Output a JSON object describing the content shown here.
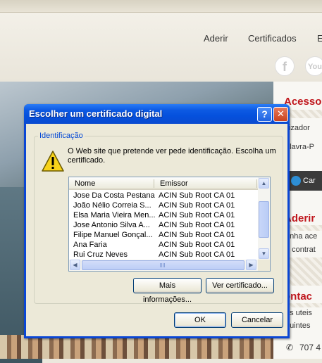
{
  "website": {
    "nav": [
      "Aderir",
      "Certificados",
      "E"
    ],
    "social": [
      "f",
      "You"
    ],
    "sidebar": {
      "section1_title": "Acesso",
      "section1_lines": [
        "ilizador",
        "alavra-P"
      ],
      "button_label": "Car",
      "section2_title": "Aderir",
      "section2_lines": [
        "enha ace",
        "e contrat"
      ],
      "section3_title": "ontac",
      "section3_lines": [
        "as uteis",
        "guintes"
      ],
      "phone": "707 4"
    }
  },
  "dialog": {
    "title": "Escolher um certificado digital",
    "help_label": "?",
    "close_label": "✕",
    "group_label": "Identificação",
    "prompt": "O Web site que pretende ver pede identificação. Escolha um certificado.",
    "columns": [
      "Nome",
      "Emissor"
    ],
    "rows": [
      {
        "name": "Jose Da Costa Pestana",
        "issuer": "ACIN Sub Root CA 01"
      },
      {
        "name": "João Nélio Correia S...",
        "issuer": "ACIN Sub Root CA 01"
      },
      {
        "name": "Elsa Maria Vieira Men...",
        "issuer": "ACIN Sub Root CA 01"
      },
      {
        "name": "Jose Antonio Silva A...",
        "issuer": "ACIN Sub Root CA 01"
      },
      {
        "name": "Filipe Manuel Gonçal...",
        "issuer": "ACIN Sub Root CA 01"
      },
      {
        "name": "Ana Faria",
        "issuer": "ACIN Sub Root CA 01"
      },
      {
        "name": "Rui Cruz Neves",
        "issuer": "ACIN Sub Root CA 01"
      }
    ],
    "buttons": {
      "more_info": "Mais informações...",
      "view_cert": "Ver certificado...",
      "ok": "OK",
      "cancel": "Cancelar"
    }
  }
}
